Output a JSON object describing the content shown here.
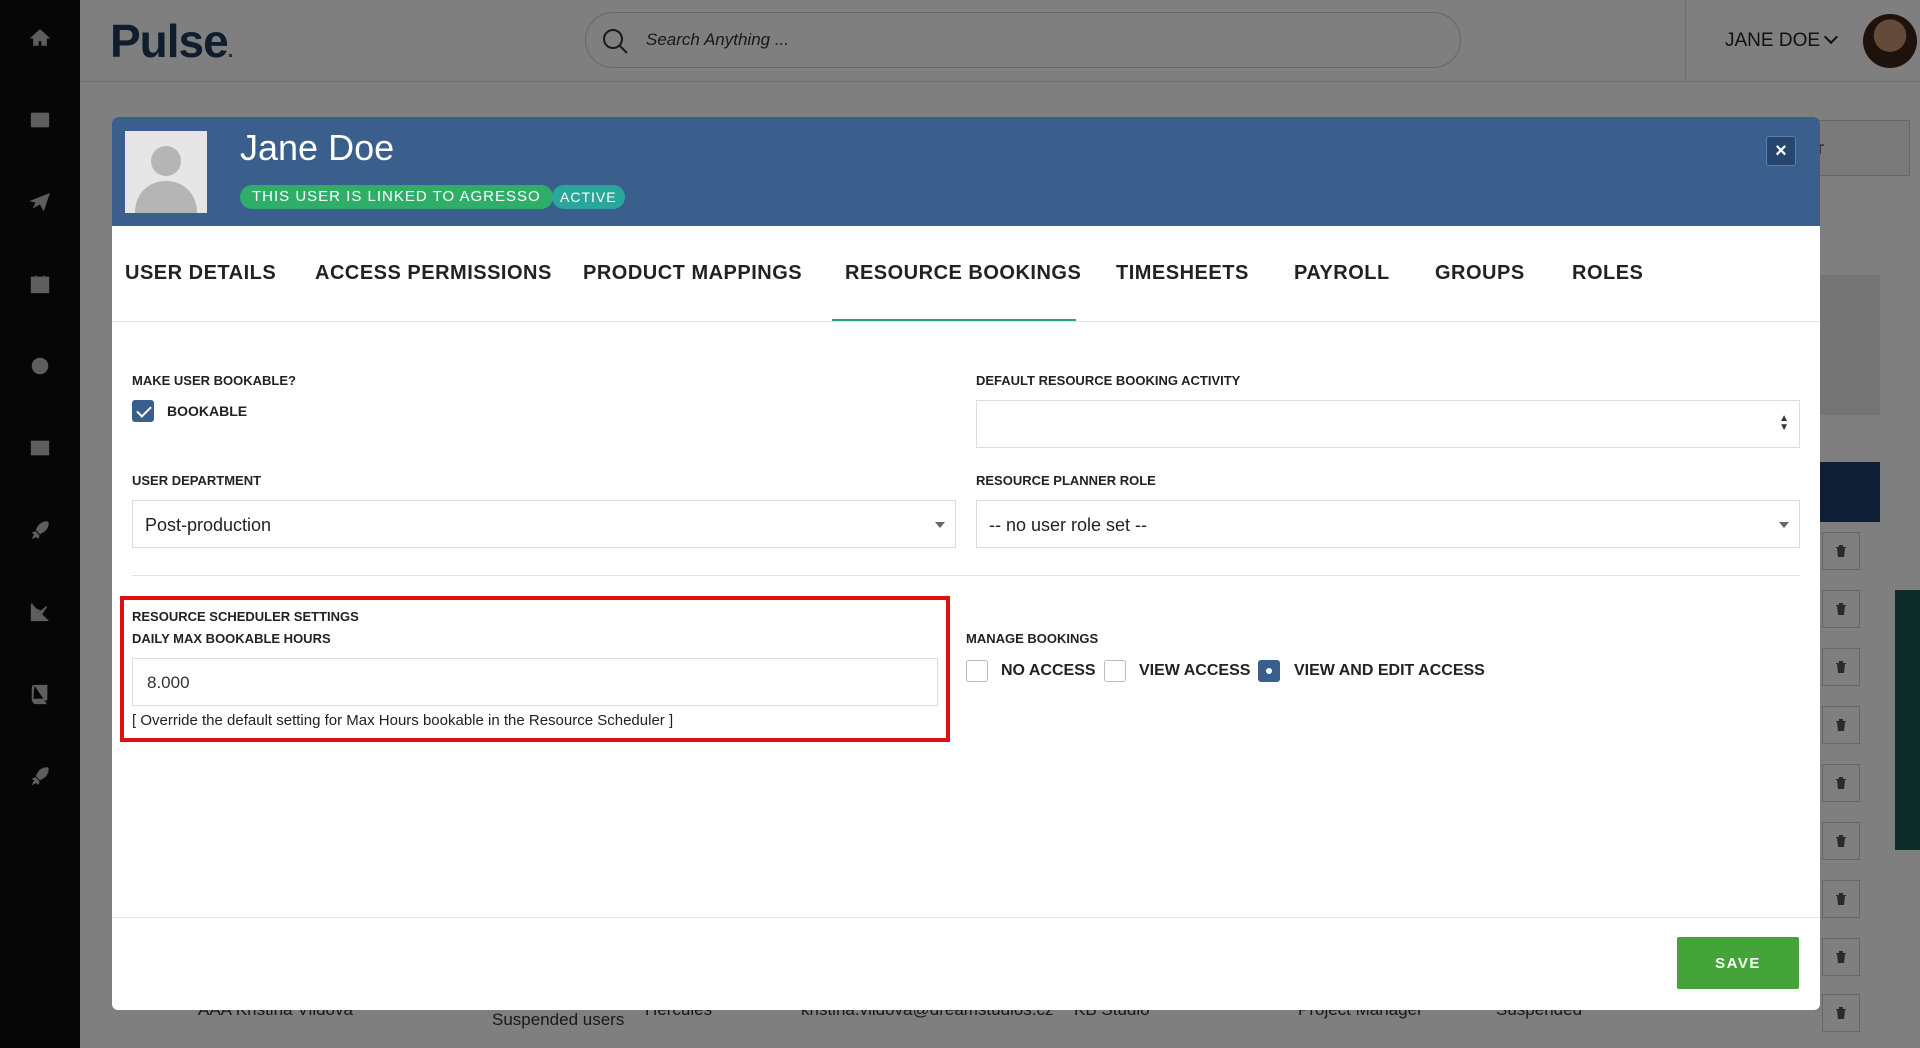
{
  "app": {
    "logo": "Pulse"
  },
  "search": {
    "placeholder": "Search Anything ..."
  },
  "user_menu": {
    "name": "JANE DOE"
  },
  "background": {
    "export_button": "ORT",
    "row": {
      "name": "AAA Kristina Vlidova",
      "group": "Suspended users",
      "team": "Hercules",
      "email": "kristina.vlidova@dreamstudios.cz",
      "studio": "KB Studio",
      "role": "Project Manager",
      "status": "Suspended"
    }
  },
  "modal": {
    "user_name": "Jane Doe",
    "badge_linked": "THIS USER IS LINKED TO AGRESSO",
    "badge_active": "ACTIVE",
    "close_label": "×",
    "tabs": [
      {
        "label": "USER DETAILS"
      },
      {
        "label": "ACCESS PERMISSIONS"
      },
      {
        "label": "PRODUCT MAPPINGS"
      },
      {
        "label": "RESOURCE BOOKINGS"
      },
      {
        "label": "TIMESHEETS"
      },
      {
        "label": "PAYROLL"
      },
      {
        "label": "GROUPS"
      },
      {
        "label": "ROLES"
      }
    ],
    "active_tab": "RESOURCE BOOKINGS",
    "form": {
      "bookable_label": "MAKE USER BOOKABLE?",
      "bookable_option": "BOOKABLE",
      "default_activity_label": "DEFAULT RESOURCE BOOKING ACTIVITY",
      "default_activity_value": "",
      "department_label": "USER DEPARTMENT",
      "department_value": "Post-production",
      "planner_role_label": "RESOURCE PLANNER ROLE",
      "planner_role_value": "-- no user role set --",
      "scheduler_settings_label": "RESOURCE SCHEDULER SETTINGS",
      "daily_max_label": "DAILY MAX BOOKABLE HOURS",
      "daily_max_value": "8.000",
      "daily_max_hint": "[ Override the default setting for Max Hours bookable in the Resource Scheduler ]",
      "manage_bookings_label": "MANAGE BOOKINGS",
      "manage_options": [
        {
          "label": "NO ACCESS",
          "selected": false
        },
        {
          "label": "VIEW ACCESS",
          "selected": false
        },
        {
          "label": "VIEW AND EDIT ACCESS",
          "selected": true
        }
      ]
    },
    "save_label": "SAVE"
  }
}
